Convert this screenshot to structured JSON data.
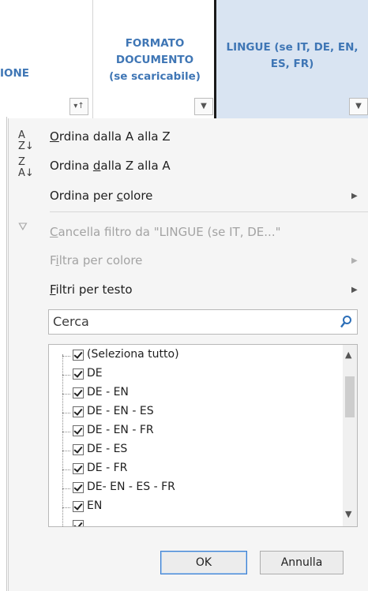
{
  "columns": {
    "col_partial": "IONE",
    "col_formato": [
      "FORMATO",
      "DOCUMENTO",
      "(se scaricabile)"
    ],
    "col_lingue": [
      "LINGUE (se IT, DE, EN,",
      "ES, FR)"
    ]
  },
  "menu": {
    "sort_az": {
      "pre": "",
      "u": "O",
      "post": "rdina dalla A alla Z"
    },
    "sort_za": {
      "pre": "Ordina ",
      "u": "d",
      "post": "alla Z alla A"
    },
    "sort_color": {
      "pre": "Ordina per ",
      "u": "c",
      "post": "olore"
    },
    "clear_filter": {
      "pre": "",
      "u": "C",
      "post": "ancella filtro da \"LINGUE (se IT, DE...\""
    },
    "filter_color": {
      "pre": "F",
      "u": "i",
      "post": "ltra per colore"
    },
    "text_filters": {
      "pre": "",
      "u": "F",
      "post": "iltri per testo"
    }
  },
  "search": {
    "placeholder": "Cerca"
  },
  "list_items": [
    "(Seleziona tutto)",
    "DE",
    "DE - EN",
    "DE - EN - ES",
    "DE - EN - FR",
    "DE - ES",
    "DE - FR",
    "DE- EN - ES - FR",
    "EN"
  ],
  "buttons": {
    "ok": "OK",
    "cancel": "Annulla"
  }
}
